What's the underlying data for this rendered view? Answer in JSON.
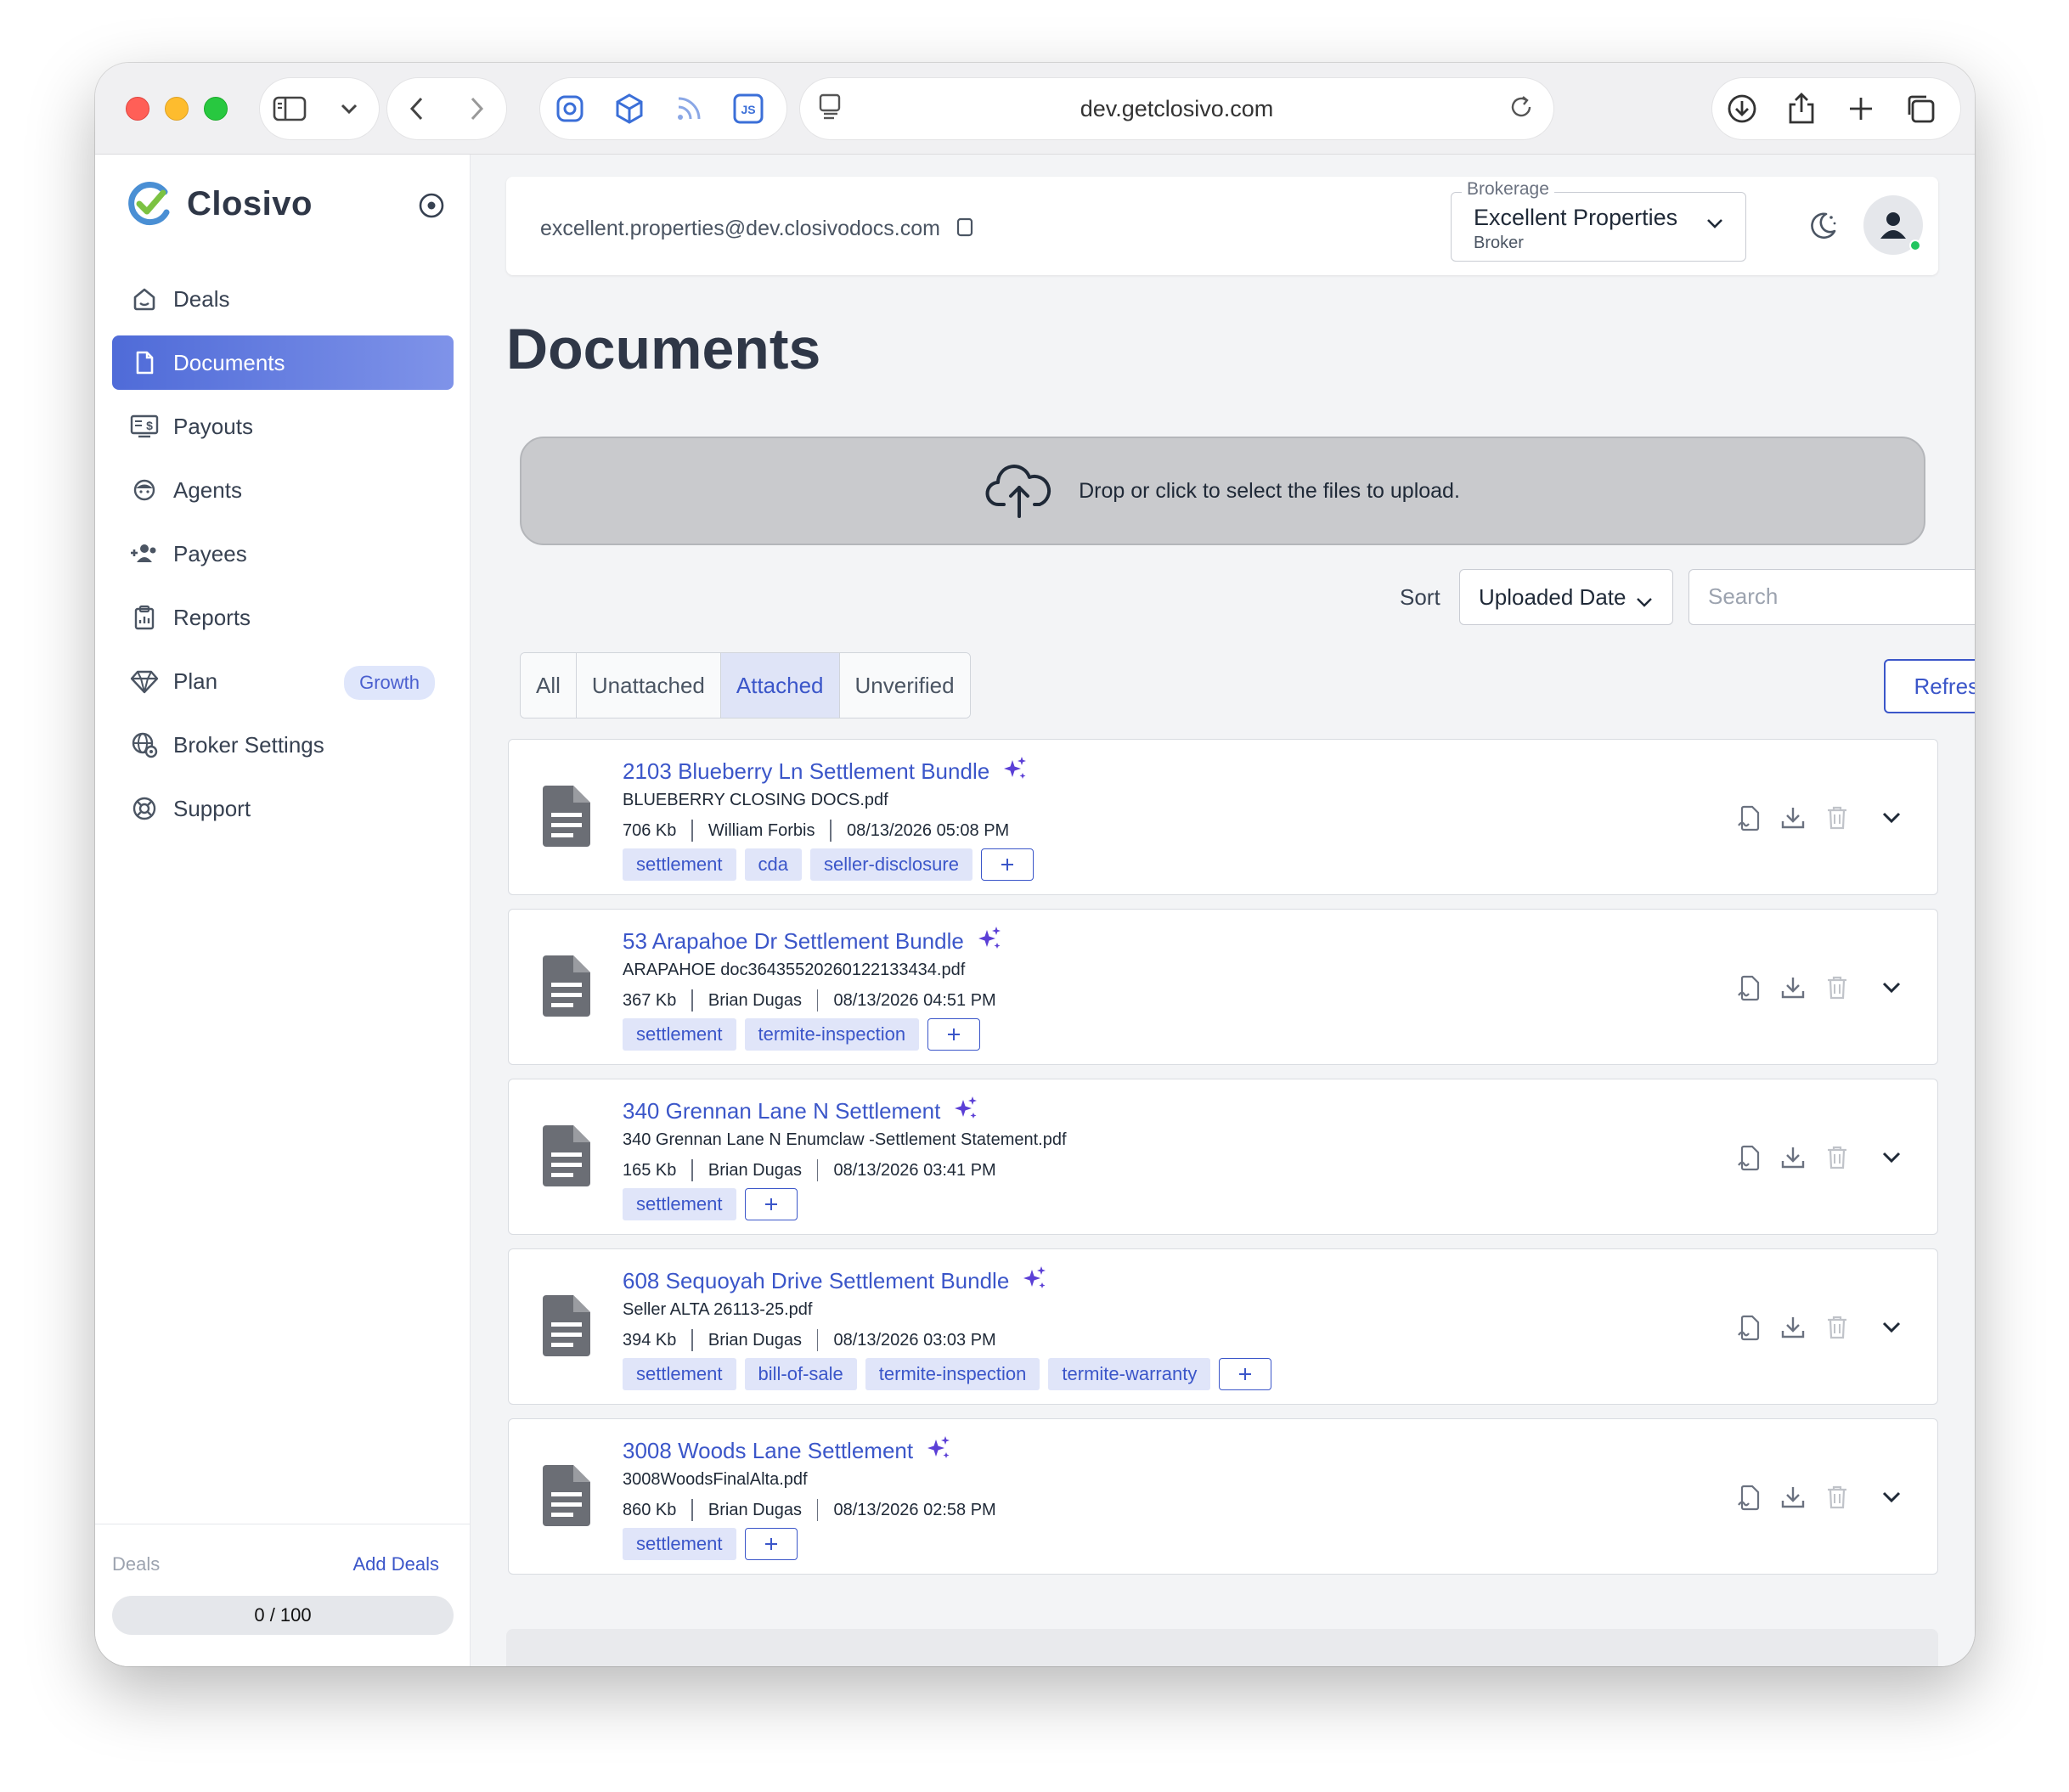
{
  "browser": {
    "url": "dev.getclosivo.com"
  },
  "sidebar": {
    "brand": "Closivo",
    "items": [
      {
        "label": "Deals",
        "icon": "house-icon"
      },
      {
        "label": "Documents",
        "icon": "document-icon",
        "active": true
      },
      {
        "label": "Payouts",
        "icon": "payouts-icon"
      },
      {
        "label": "Agents",
        "icon": "agent-icon"
      },
      {
        "label": "Payees",
        "icon": "payees-icon"
      },
      {
        "label": "Reports",
        "icon": "clipboard-icon"
      },
      {
        "label": "Plan",
        "icon": "diamond-icon",
        "badge": "Growth"
      },
      {
        "label": "Broker Settings",
        "icon": "globe-icon"
      },
      {
        "label": "Support",
        "icon": "lifebuoy-icon"
      }
    ],
    "footer": {
      "deals_label": "Deals",
      "add_deals": "Add Deals",
      "deals_count": "0 / 100",
      "deals_used_fraction": 0
    }
  },
  "header": {
    "email": "excellent.properties@dev.closivodocs.com",
    "brokerage_legend": "Brokerage",
    "brokerage_name": "Excellent Properties",
    "brokerage_role": "Broker"
  },
  "page": {
    "title": "Documents",
    "dropzone_text": "Drop or click to select the files to upload.",
    "sort_label": "Sort",
    "sort_value": "Uploaded Date",
    "search_placeholder": "Search",
    "tabs": [
      {
        "label": "All"
      },
      {
        "label": "Unattached"
      },
      {
        "label": "Attached",
        "active": true
      },
      {
        "label": "Unverified"
      }
    ],
    "refresh_label": "Refresh"
  },
  "documents": [
    {
      "title": "2103 Blueberry Ln Settlement Bundle",
      "filename": "BLUEBERRY CLOSING DOCS.pdf",
      "size": "706 Kb",
      "uploader": "William Forbis",
      "date": "08/13/2026 05:08 PM",
      "tags": [
        "settlement",
        "cda",
        "seller-disclosure"
      ]
    },
    {
      "title": "53 Arapahoe Dr Settlement Bundle",
      "filename": "ARAPAHOE doc36435520260122133434.pdf",
      "size": "367 Kb",
      "uploader": "Brian Dugas",
      "date": "08/13/2026 04:51 PM",
      "tags": [
        "settlement",
        "termite-inspection"
      ]
    },
    {
      "title": "340 Grennan Lane N Settlement",
      "filename": "340 Grennan Lane N Enumclaw -Settlement Statement.pdf",
      "size": "165 Kb",
      "uploader": "Brian Dugas",
      "date": "08/13/2026 03:41 PM",
      "tags": [
        "settlement"
      ]
    },
    {
      "title": "608 Sequoyah Drive Settlement Bundle",
      "filename": "Seller ALTA 26113-25.pdf",
      "size": "394 Kb",
      "uploader": "Brian Dugas",
      "date": "08/13/2026 03:03 PM",
      "tags": [
        "settlement",
        "bill-of-sale",
        "termite-inspection",
        "termite-warranty"
      ]
    },
    {
      "title": "3008 Woods Lane Settlement",
      "filename": "3008WoodsFinalAlta.pdf",
      "size": "860 Kb",
      "uploader": "Brian Dugas",
      "date": "08/13/2026 02:58 PM",
      "tags": [
        "settlement"
      ]
    }
  ],
  "colors": {
    "accent": "#3b56c9",
    "tag_bg": "#e0e5f9",
    "active_nav_start": "#4f6bd8",
    "active_nav_end": "#7f93e9",
    "online_dot": "#22c55e"
  }
}
